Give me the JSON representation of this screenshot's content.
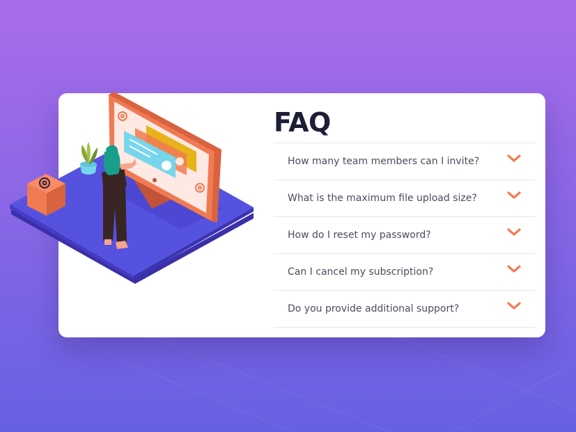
{
  "faq": {
    "title": "FAQ",
    "items": [
      {
        "question": "How many team members can I invite?",
        "icon": "chevron-down-icon"
      },
      {
        "question": "What is the maximum file upload size?",
        "icon": "chevron-down-icon"
      },
      {
        "question": "How do I reset my password?",
        "icon": "chevron-down-icon"
      },
      {
        "question": "Can I cancel my subscription?",
        "icon": "chevron-down-icon"
      },
      {
        "question": "Do you provide additional support?",
        "icon": "chevron-down-icon"
      }
    ]
  },
  "colors": {
    "background_top": "#a96ceb",
    "background_bottom": "#6661e2",
    "card": "#ffffff",
    "title": "#1e1f36",
    "question_text": "#4b4c5f",
    "chevron": "#f47b56",
    "divider": "#e8e8ea"
  }
}
